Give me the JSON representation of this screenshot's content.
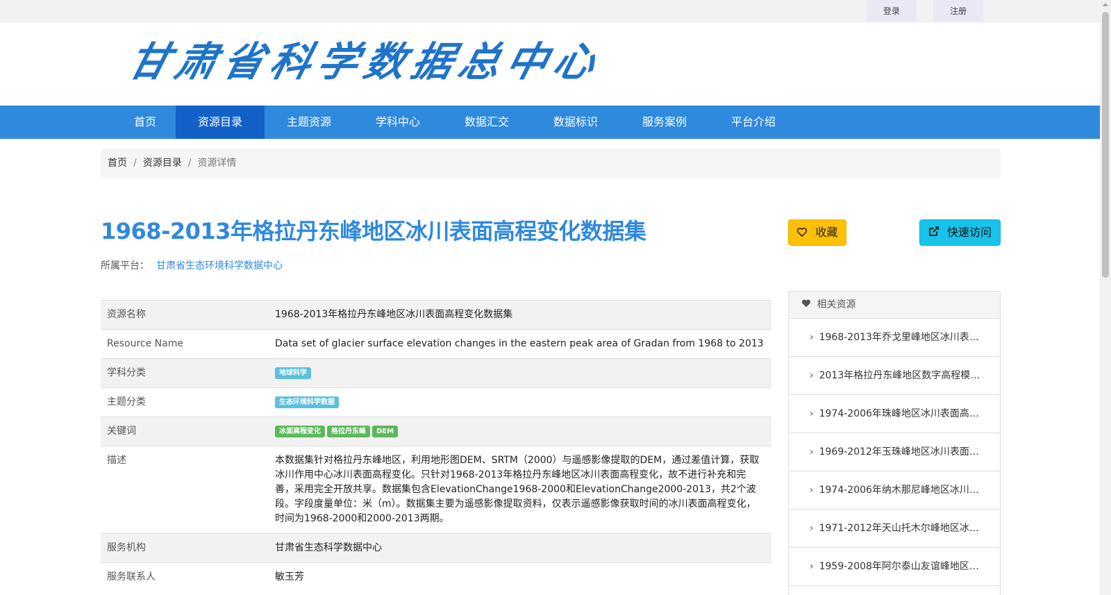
{
  "topbar": {
    "login_label": "登录",
    "register_label": "注册"
  },
  "header": {
    "logo_text": "甘肃省科学数据总中心"
  },
  "nav": {
    "items": [
      {
        "label": "首页"
      },
      {
        "label": "资源目录"
      },
      {
        "label": "主题资源"
      },
      {
        "label": "学科中心"
      },
      {
        "label": "数据汇交"
      },
      {
        "label": "数据标识"
      },
      {
        "label": "服务案例"
      },
      {
        "label": "平台介绍"
      }
    ],
    "active_index": 1
  },
  "breadcrumb": {
    "home": "首页",
    "catalog": "资源目录",
    "current": "资源详情",
    "separator": "/"
  },
  "page": {
    "title": "1968-2013年格拉丹东峰地区冰川表面高程变化数据集",
    "platform_label": "所属平台：",
    "platform_value": "甘肃省生态环境科学数据中心",
    "favorite_label": "收藏",
    "quick_access_label": "快速访问"
  },
  "info": {
    "resource_name_key": "资源名称",
    "resource_name_value": "1968-2013年格拉丹东峰地区冰川表面高程变化数据集",
    "resource_name_en_key": "Resource Name",
    "resource_name_en_value": "Data set of glacier surface elevation changes in the eastern peak area of Gradan from 1968 to 2013",
    "discipline_key": "学科分类",
    "discipline_tags": [
      "地球科学"
    ],
    "theme_key": "主题分类",
    "theme_tags": [
      "生态环境科学数据"
    ],
    "keywords_key": "关键词",
    "keyword_tags": [
      "冰面高程变化",
      "格拉丹东峰",
      "DEM"
    ],
    "description_key": "描述",
    "description_value": "本数据集针对格拉丹东峰地区，利用地形图DEM、SRTM（2000）与遥感影像提取的DEM，通过差值计算，获取冰川作用中心冰川表面高程变化。只针对1968-2013年格拉丹东峰地区冰川表面高程变化，故不进行补充和完善，采用完全开放共享。数据集包含ElevationChange1968-2000和ElevationChange2000-2013，共2个波段。字段度量单位：米（m）。数据集主要为遥感影像提取资料，仅表示遥感影像获取时间的冰川表面高程变化，时间为1968-2000和2000-2013两期。",
    "org_key": "服务机构",
    "org_value": "甘肃省生态科学数据中心",
    "contact_key": "服务联系人",
    "contact_value": "敏玉芳"
  },
  "related": {
    "header": "相关资源",
    "items": [
      "1968-2013年乔戈里峰地区冰川表…",
      "2013年格拉丹东峰地区数字高程模…",
      "1974-2006年珠峰地区冰川表面高…",
      "1969-2012年玉珠峰地区冰川表面…",
      "1974-2006年纳木那尼峰地区冰川…",
      "1971-2012年天山托木尔峰地区冰…",
      "1959-2008年阿尔泰山友谊峰地区…"
    ]
  },
  "colors": {
    "primary": "#2f89dd",
    "nav_active": "#1360c9",
    "favorite": "#ffc107",
    "quick_access": "#17c3e8",
    "tag_blue": "#5bc0de",
    "tag_green": "#5cb85c"
  },
  "icons": {
    "favorite": "heart-outline-icon",
    "quick_access": "external-link-icon",
    "related_header": "heart-icon",
    "related_item": "chevron-right-icon"
  }
}
